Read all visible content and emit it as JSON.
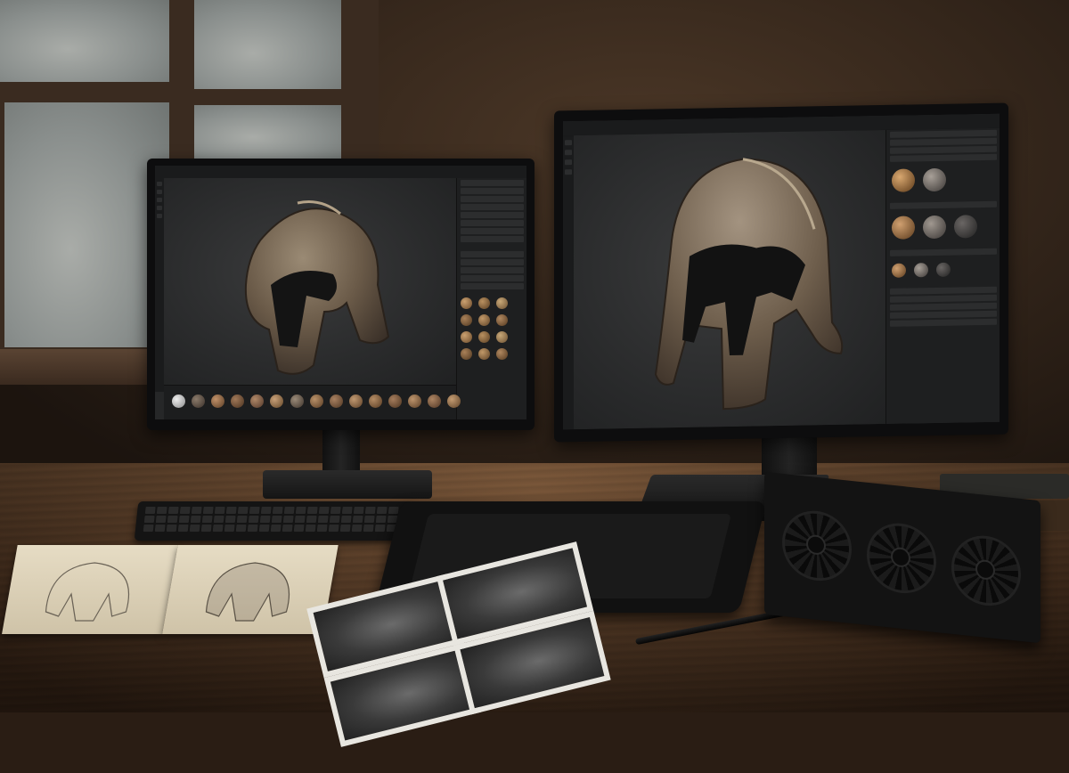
{
  "scene": {
    "description_type": "photo of a 3D texturing workstation",
    "colors": {
      "wall": "#3d2c20",
      "desk": "#5a3c26",
      "screen_bg": "#262728",
      "panel_bg": "#1e1f20",
      "helmet_metal": "#7a6a58"
    }
  },
  "left_monitor": {
    "icons": [
      "helmet-render",
      "material-sphere",
      "toolbar-icon"
    ]
  },
  "right_monitor": {
    "icons": [
      "helmet-render",
      "material-sphere",
      "toolbar-icon"
    ]
  },
  "desk_items": [
    "keyboard",
    "pen-tablet",
    "stylus",
    "graphics-card",
    "sketchbook",
    "reference-photos",
    "books"
  ]
}
